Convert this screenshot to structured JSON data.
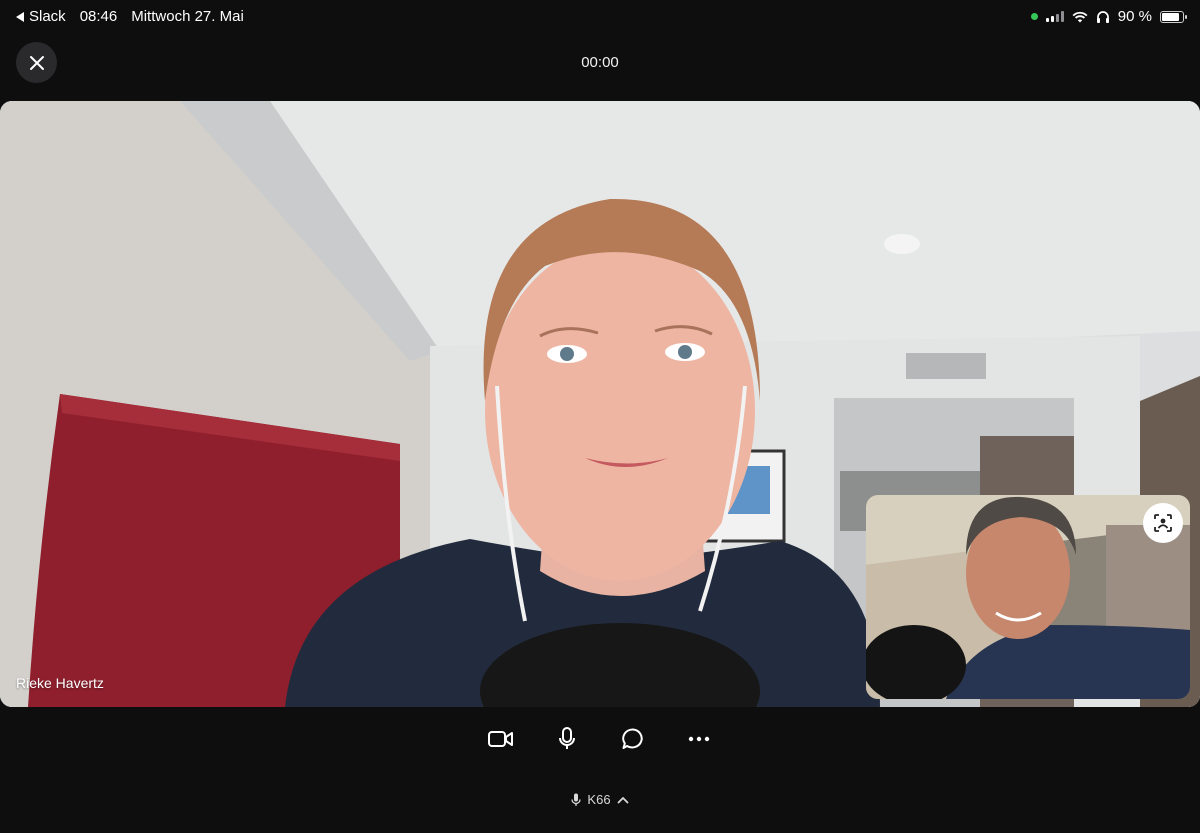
{
  "status_bar": {
    "back_app": "Slack",
    "time": "08:46",
    "date": "Mittwoch 27. Mai",
    "battery": "90 %",
    "battery_level": 0.9,
    "privacy_dot_color": "#34c759",
    "icons": [
      "back-arrow-icon",
      "cellular-signal-icon",
      "wifi-icon",
      "headphones-icon",
      "battery-icon"
    ]
  },
  "call": {
    "timer": "00:00",
    "caller_name": "Rieke Havertz"
  },
  "controls": {
    "icons": [
      "close-icon",
      "camera-icon",
      "microphone-icon",
      "chat-icon",
      "more-icon",
      "switch-camera-icon"
    ]
  },
  "audio_device": {
    "label": "K66",
    "icons": [
      "microphone-small-icon",
      "chevron-up-icon"
    ]
  }
}
